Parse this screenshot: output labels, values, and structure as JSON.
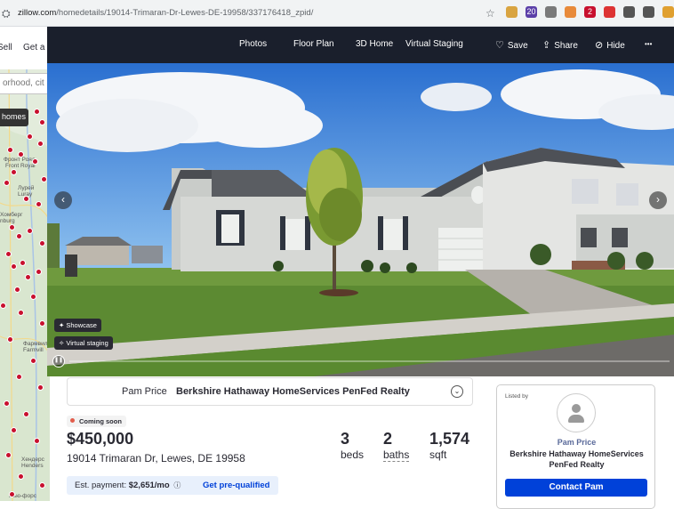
{
  "browser": {
    "url_host": "zillow.com",
    "url_path": "/homedetails/19014-Trimaran-Dr-Lewes-DE-19958/337176418_zpid/",
    "extensions": [
      {
        "icon": "bag-icon",
        "color": "#d9a441"
      },
      {
        "icon": "badge-icon",
        "color": "#5b3fa8",
        "text": "20"
      },
      {
        "icon": "hat-icon",
        "color": "#7a7a7a"
      },
      {
        "icon": "leaf-icon",
        "color": "#e88a3a"
      },
      {
        "icon": "record-icon",
        "color": "#c8102e",
        "text": "2"
      },
      {
        "icon": "box-icon",
        "color": "#d33"
      },
      {
        "icon": "puzzle-icon",
        "color": "#555"
      },
      {
        "icon": "menu-icon",
        "color": "#555"
      },
      {
        "icon": "profile-icon",
        "color": "#e0a030"
      }
    ]
  },
  "map_panel": {
    "tabs": [
      "Sell",
      "Get a r"
    ],
    "search_placeholder": "orhood, cit",
    "homes_button": "homes",
    "labels": [
      "Фронт Роял",
      "Front Royal",
      "Лурей",
      "Luray",
      "Хомберг",
      "nburg",
      "Фармвил",
      "Farmvill",
      "Хендерс",
      "Henders",
      "Нью-форс"
    ]
  },
  "photo_nav": {
    "photos": "Photos",
    "floor_plan": "Floor Plan",
    "home_3d": "3D Home",
    "virtual_staging": "Virtual Staging",
    "save": "Save",
    "share": "Share",
    "hide": "Hide",
    "more": "•••"
  },
  "hero": {
    "showcase_label": "Showcase",
    "virtual_staging_label": "Virtual staging",
    "progress": 0.0
  },
  "listing": {
    "agent_name": "Pam Price",
    "brokerage": "Berkshire Hathaway HomeServices PenFed Realty",
    "status": "Coming soon",
    "price": "$450,000",
    "address": "19014 Trimaran Dr, Lewes, DE 19958",
    "beds_value": "3",
    "beds_label": "beds",
    "baths_value": "2",
    "baths_label": "baths",
    "sqft_value": "1,574",
    "sqft_label": "sqft",
    "est_payment_label": "Est. payment:",
    "est_payment_value": "$2,651/mo",
    "prequalify": "Get pre-qualified"
  },
  "listed_by_card": {
    "label": "Listed by",
    "agent_name": "Pam Price",
    "brokerage_line1": "Berkshire Hathaway HomeServices",
    "brokerage_line2": "PenFed Realty",
    "contact_button": "Contact Pam"
  }
}
